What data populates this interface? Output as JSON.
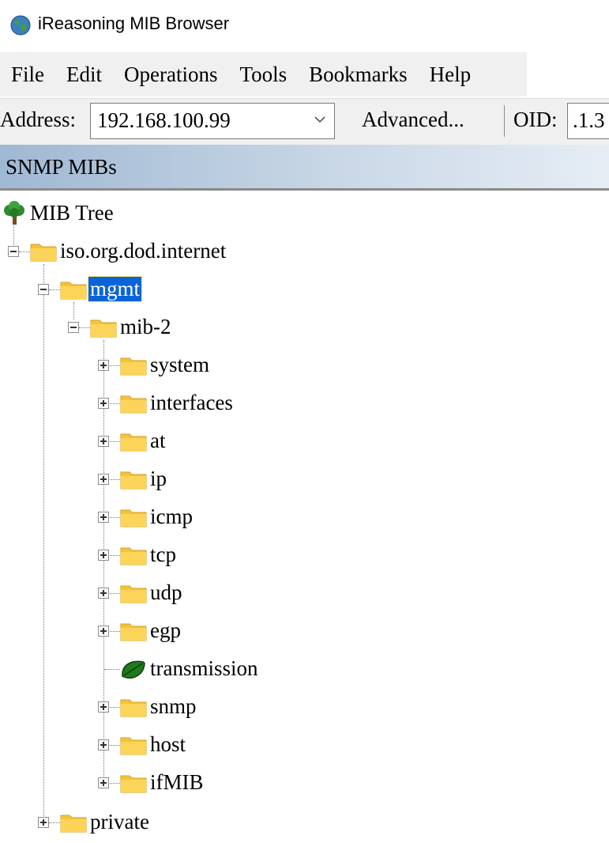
{
  "window": {
    "title": "iReasoning MIB Browser",
    "icon": "globe-icon"
  },
  "menu": [
    "File",
    "Edit",
    "Operations",
    "Tools",
    "Bookmarks",
    "Help"
  ],
  "toolbar": {
    "address_label": "Address:",
    "address_value": "192.168.100.99",
    "advanced_label": "Advanced...",
    "oid_label": "OID:",
    "oid_value": ".1.3"
  },
  "panel": {
    "title": "SNMP MIBs"
  },
  "tree": {
    "root": {
      "label": "MIB Tree",
      "icon": "tree-icon"
    },
    "iso": {
      "label": "iso.org.dod.internet"
    },
    "mgmt": {
      "label": "mgmt",
      "selected": true
    },
    "mib2": {
      "label": "mib-2"
    },
    "children": [
      {
        "label": "system",
        "icon": "folder-icon"
      },
      {
        "label": "interfaces",
        "icon": "folder-icon"
      },
      {
        "label": "at",
        "icon": "folder-icon"
      },
      {
        "label": "ip",
        "icon": "folder-icon"
      },
      {
        "label": "icmp",
        "icon": "folder-icon"
      },
      {
        "label": "tcp",
        "icon": "folder-icon"
      },
      {
        "label": "udp",
        "icon": "folder-icon"
      },
      {
        "label": "egp",
        "icon": "folder-icon"
      },
      {
        "label": "transmission",
        "icon": "leaf-icon"
      },
      {
        "label": "snmp",
        "icon": "folder-icon"
      },
      {
        "label": "host",
        "icon": "folder-icon"
      },
      {
        "label": "ifMIB",
        "icon": "folder-icon"
      }
    ],
    "private": {
      "label": "private"
    }
  },
  "colors": {
    "selection": "#0a64d8",
    "folder": "#f5c33b"
  }
}
